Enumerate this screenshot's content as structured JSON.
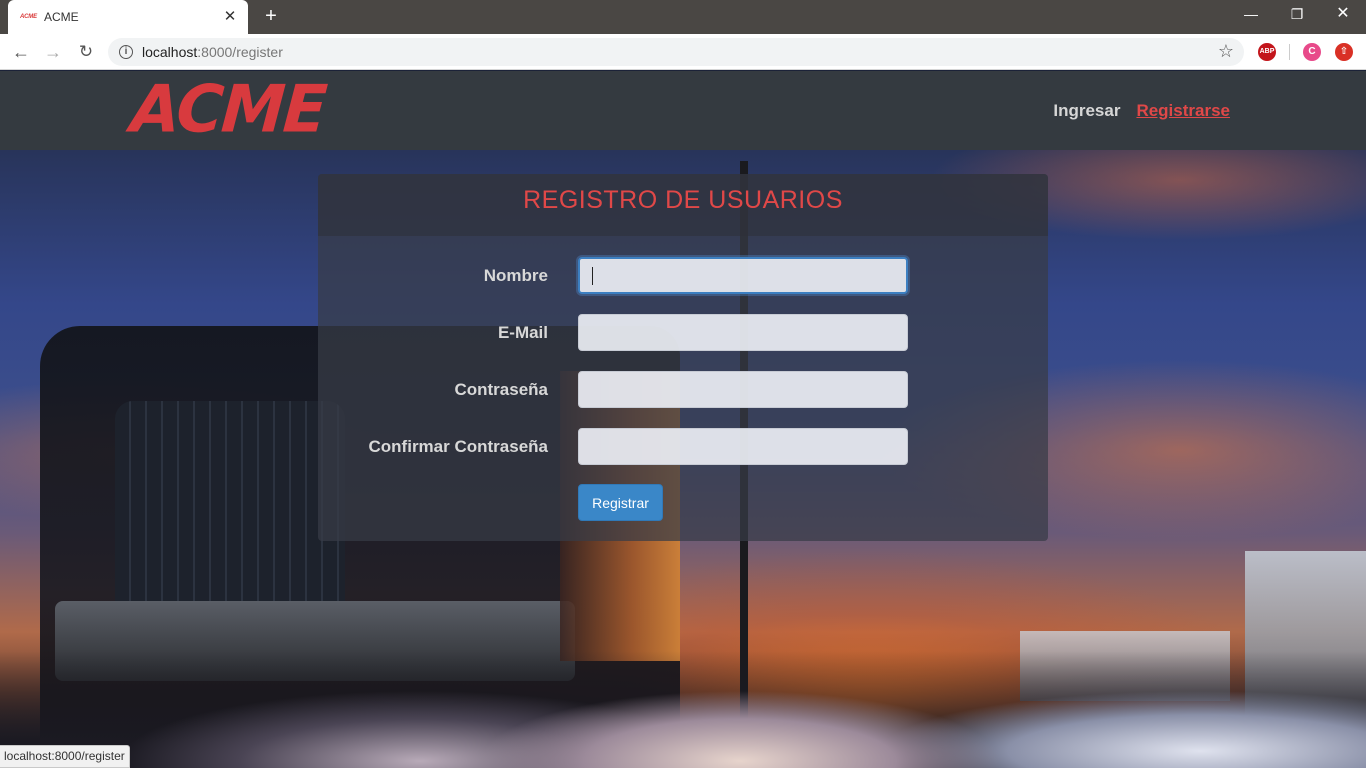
{
  "browser": {
    "tab_title": "ACME",
    "favicon_text": "ACME",
    "tab_close": "✕",
    "new_tab": "+",
    "url_host": "localhost",
    "url_path": ":8000/register",
    "status_url": "localhost:8000/register",
    "extensions": {
      "abp": "ABP",
      "avatar": "C"
    }
  },
  "header": {
    "logo": "ACME",
    "nav": [
      {
        "label": "Ingresar",
        "active": false
      },
      {
        "label": "Registrarse",
        "active": true
      }
    ]
  },
  "form": {
    "title": "REGISTRO DE USUARIOS",
    "fields": [
      {
        "label": "Nombre",
        "value": "",
        "focused": true
      },
      {
        "label": "E-Mail",
        "value": ""
      },
      {
        "label": "Contraseña",
        "value": ""
      },
      {
        "label": "Confirmar Contraseña",
        "value": ""
      }
    ],
    "submit_label": "Registrar"
  },
  "colors": {
    "brand_red": "#d83a3e",
    "navbar": "#343a40",
    "button_blue": "#3a87c8"
  }
}
